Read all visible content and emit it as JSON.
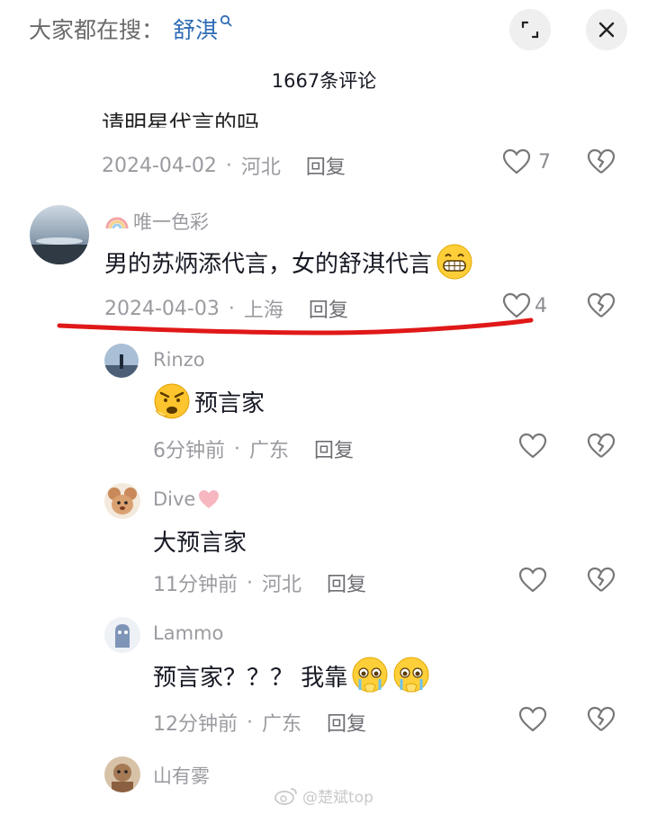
{
  "header": {
    "search_prefix": "大家都在搜：",
    "search_keyword": "舒淇"
  },
  "comment_count_label": "1667条评论",
  "comments": [
    {
      "text_partial": "请明星代言的吗",
      "date": "2024-04-02",
      "location": "河北",
      "reply_label": "回复",
      "likes": "7"
    },
    {
      "author": "唯一色彩",
      "text": "男的苏炳添代言，女的舒淇代言",
      "date": "2024-04-03",
      "location": "上海",
      "reply_label": "回复",
      "likes": "4"
    }
  ],
  "replies": [
    {
      "author": "Rinzo",
      "text": "预言家",
      "time": "6分钟前",
      "location": "广东",
      "reply_label": "回复"
    },
    {
      "author": "Dive",
      "text": "大预言家",
      "time": "11分钟前",
      "location": "河北",
      "reply_label": "回复"
    },
    {
      "author": "Lammo",
      "text": "预言家？？？ 我靠",
      "time": "12分钟前",
      "location": "广东",
      "reply_label": "回复"
    },
    {
      "author": "山有雾"
    }
  ],
  "watermark": "@楚斌top",
  "colors": {
    "keyword_blue": "#2f6cb5",
    "meta_gray": "#9a9ba0",
    "underline_red": "#e01818"
  },
  "icons": [
    "search-icon",
    "expand-icon",
    "close-icon",
    "heart-icon",
    "broken-heart-icon",
    "rainbow-icon",
    "grin-emoji",
    "angry-emoji",
    "teary-emoji",
    "pink-heart-icon",
    "weibo-icon"
  ]
}
